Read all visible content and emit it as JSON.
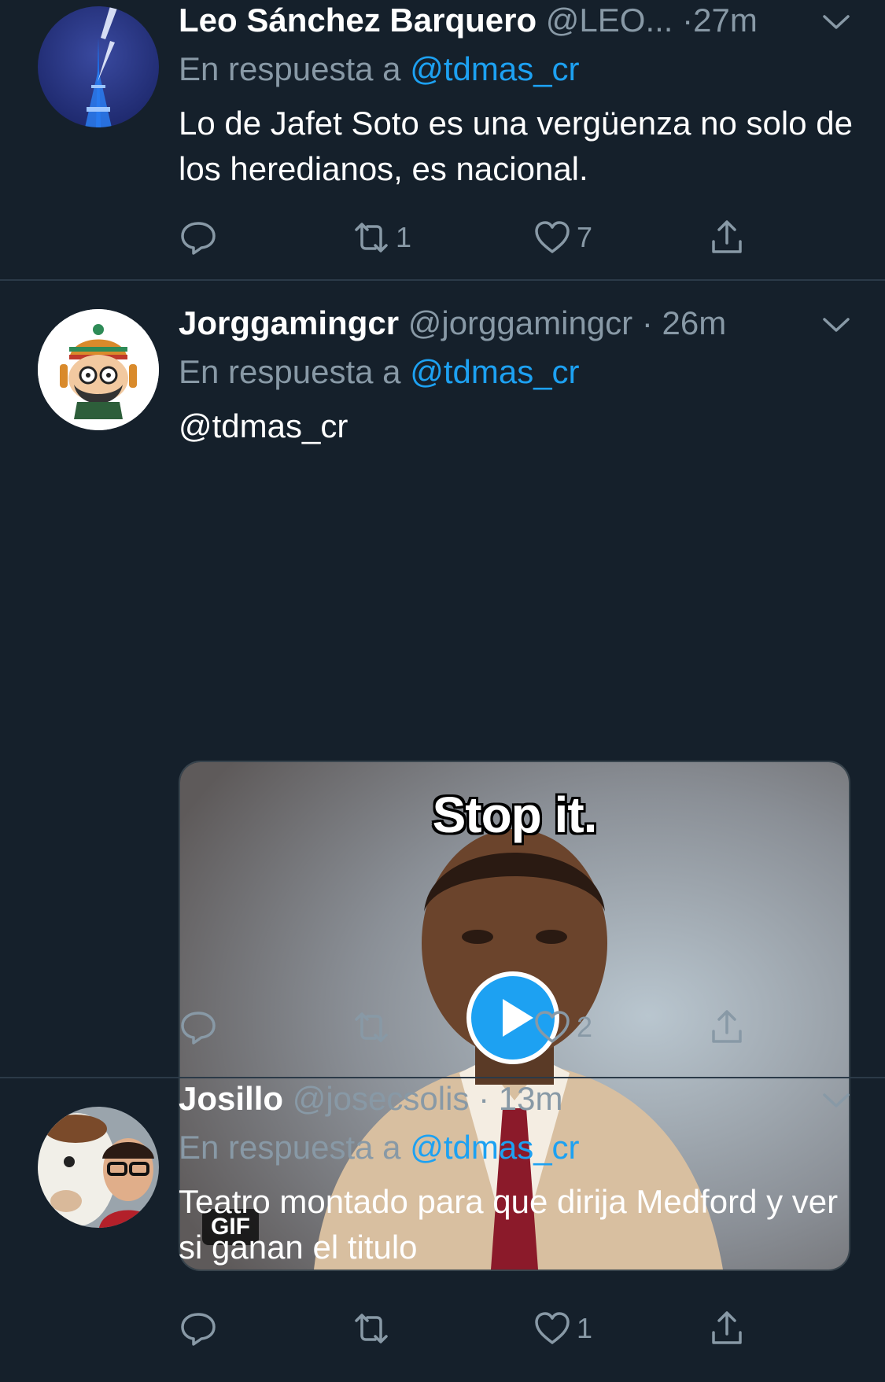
{
  "colors": {
    "background": "#15202b",
    "accent": "#1da1f2",
    "secondary_text": "#8899a6",
    "divider": "#2b3a48"
  },
  "tweets": [
    {
      "display_name": "Leo Sánchez Barquero",
      "handle": "@LEO...",
      "separator": "·",
      "time": "27m",
      "reply_prefix": "En respuesta a",
      "reply_to": "@tdmas_cr",
      "text": "Lo de Jafet Soto es una vergüenza no solo de los heredianos, es nacional.",
      "avatar_icon": "eiffel-tower-lightning-avatar",
      "actions": {
        "reply": "",
        "retweet": "1",
        "like": "7"
      }
    },
    {
      "display_name": "Jorggamingcr",
      "handle": "@jorggamingcr",
      "separator": "·",
      "time": "26m",
      "reply_prefix": "En respuesta a",
      "reply_to": "@tdmas_cr",
      "text": "@tdmas_cr",
      "avatar_icon": "cartoon-character-avatar",
      "media": {
        "caption": "Stop it.",
        "badge": "GIF",
        "icon": "play-icon"
      },
      "actions": {
        "reply": "",
        "retweet": "",
        "like": "2"
      }
    },
    {
      "display_name": "Josillo",
      "handle": "@josecsolis",
      "separator": "·",
      "time": "13m",
      "reply_prefix": "En respuesta a",
      "reply_to": "@tdmas_cr",
      "text": "Teatro montado para que dirija Medford y ver si ganan el titulo",
      "avatar_icon": "selfie-avatar",
      "actions": {
        "reply": "",
        "retweet": "",
        "like": "1"
      }
    }
  ]
}
